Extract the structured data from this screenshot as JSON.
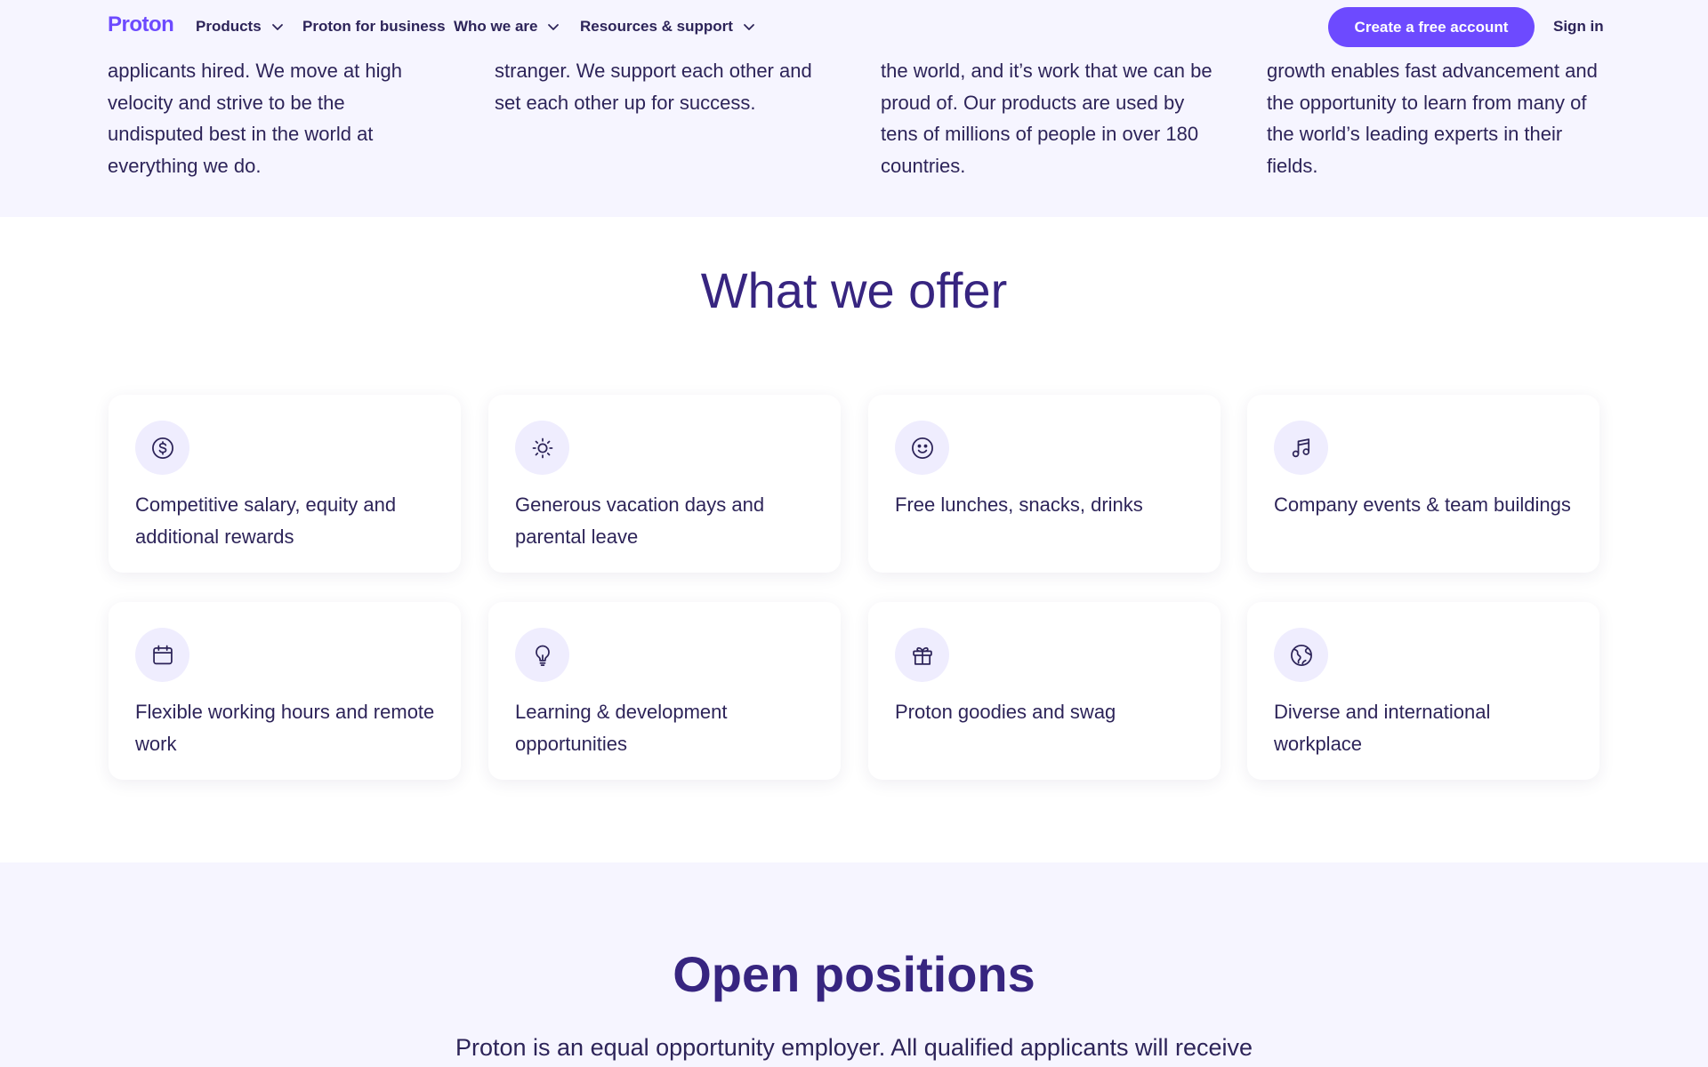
{
  "header": {
    "logo": "Proton",
    "nav": [
      {
        "label": "Products",
        "has_dropdown": true
      },
      {
        "label": "Proton for business",
        "has_dropdown": false
      },
      {
        "label": "Who we are",
        "has_dropdown": true
      },
      {
        "label": "Resources & support",
        "has_dropdown": true
      }
    ],
    "cta": "Create a free account",
    "signin": "Sign in"
  },
  "values": [
    "applicants hired. We move at high velocity and strive to be the undisputed best in the world at everything we do.",
    "stranger. We support each other and set each other up for success.",
    "the world, and it’s work that we can be proud of. Our products are used by tens of millions of people in over 180 countries.",
    "growth enables fast advancement and the opportunity to learn from many of the world’s leading experts in their fields."
  ],
  "offer": {
    "title": "What we offer",
    "items": [
      {
        "icon": "dollar-icon",
        "label": "Competitive salary, equity and additional rewards"
      },
      {
        "icon": "sun-icon",
        "label": "Generous vacation days and parental leave"
      },
      {
        "icon": "smiley-icon",
        "label": "Free lunches, snacks, drinks"
      },
      {
        "icon": "music-note-icon",
        "label": "Company events & team buildings"
      },
      {
        "icon": "calendar-icon",
        "label": "Flexible working hours and remote work"
      },
      {
        "icon": "lightbulb-icon",
        "label": "Learning & development opportunities"
      },
      {
        "icon": "gift-icon",
        "label": "Proton goodies and swag"
      },
      {
        "icon": "globe-icon",
        "label": "Diverse and international workplace"
      }
    ]
  },
  "positions": {
    "title": "Open positions",
    "text": "Proton is an equal opportunity employer. All qualified applicants will receive"
  },
  "colors": {
    "brand": "#6d4aff",
    "heading": "#372580",
    "text": "#2d2459",
    "section_bg": "#f6f5ff",
    "icon_bg": "#efedfe"
  }
}
